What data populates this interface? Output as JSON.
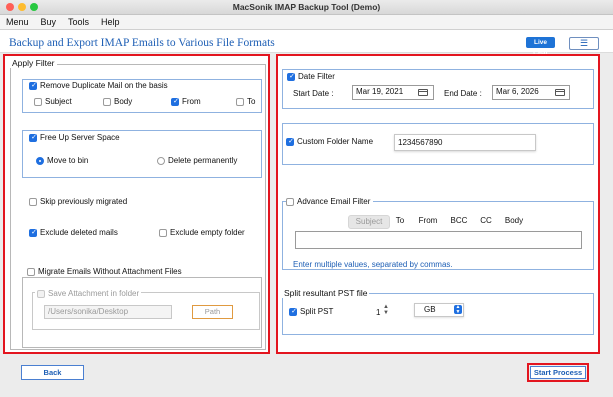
{
  "window": {
    "title": "MacSonik IMAP Backup Tool (Demo)"
  },
  "colors": {
    "accent": "#1e73d6",
    "highlight_border": "#e3151f",
    "link_text": "#1e5fb5"
  },
  "menu": [
    "Menu",
    "Buy",
    "Tools",
    "Help"
  ],
  "header": {
    "title": "Backup and Export IMAP Emails to Various File Formats",
    "live_chat": "Live Chat",
    "menu_icon": "hamburger-icon"
  },
  "apply_filter": {
    "legend": "Apply Filter",
    "remove_duplicate": {
      "label": "Remove Duplicate Mail on the basis",
      "checked": true,
      "options": [
        {
          "label": "Subject",
          "checked": false
        },
        {
          "label": "Body",
          "checked": false
        },
        {
          "label": "From",
          "checked": true
        },
        {
          "label": "To",
          "checked": false
        }
      ]
    },
    "free_up": {
      "label": "Free Up Server Space",
      "checked": true,
      "options": [
        {
          "label": "Move to bin",
          "selected": true
        },
        {
          "label": "Delete permanently",
          "selected": false
        }
      ]
    },
    "skip_migrated": {
      "label": "Skip previously migrated",
      "checked": false
    },
    "exclude_deleted": {
      "label": "Exclude deleted mails",
      "checked": true
    },
    "exclude_empty": {
      "label": "Exclude empty folder",
      "checked": false
    },
    "migrate_no_attach": {
      "label": "Migrate Emails Without Attachment Files",
      "checked": false
    },
    "save_attachment": {
      "label": "Save Attachment in folder",
      "checked": false,
      "path": "/Users/sonika/Desktop",
      "path_button": "Path"
    }
  },
  "date_filter": {
    "label": "Date Filter",
    "checked": true,
    "start_label": "Start Date :",
    "start_value": "Mar 19, 2021",
    "end_label": "End Date :",
    "end_value": "Mar 6, 2026"
  },
  "custom_folder": {
    "label": "Custom Folder Name",
    "checked": true,
    "value": "1234567890"
  },
  "advance_filter": {
    "label": "Advance Email Filter",
    "checked": false,
    "tabs": [
      "Subject",
      "To",
      "From",
      "BCC",
      "CC",
      "Body"
    ],
    "selected_tab": 0,
    "input_value": "",
    "hint": "Enter multiple values, separated by commas."
  },
  "split_pst": {
    "legend": "Split resultant PST file",
    "label": "Split PST",
    "checked": true,
    "value": "1",
    "unit": "GB"
  },
  "buttons": {
    "back": "Back",
    "start": "Start Process"
  }
}
